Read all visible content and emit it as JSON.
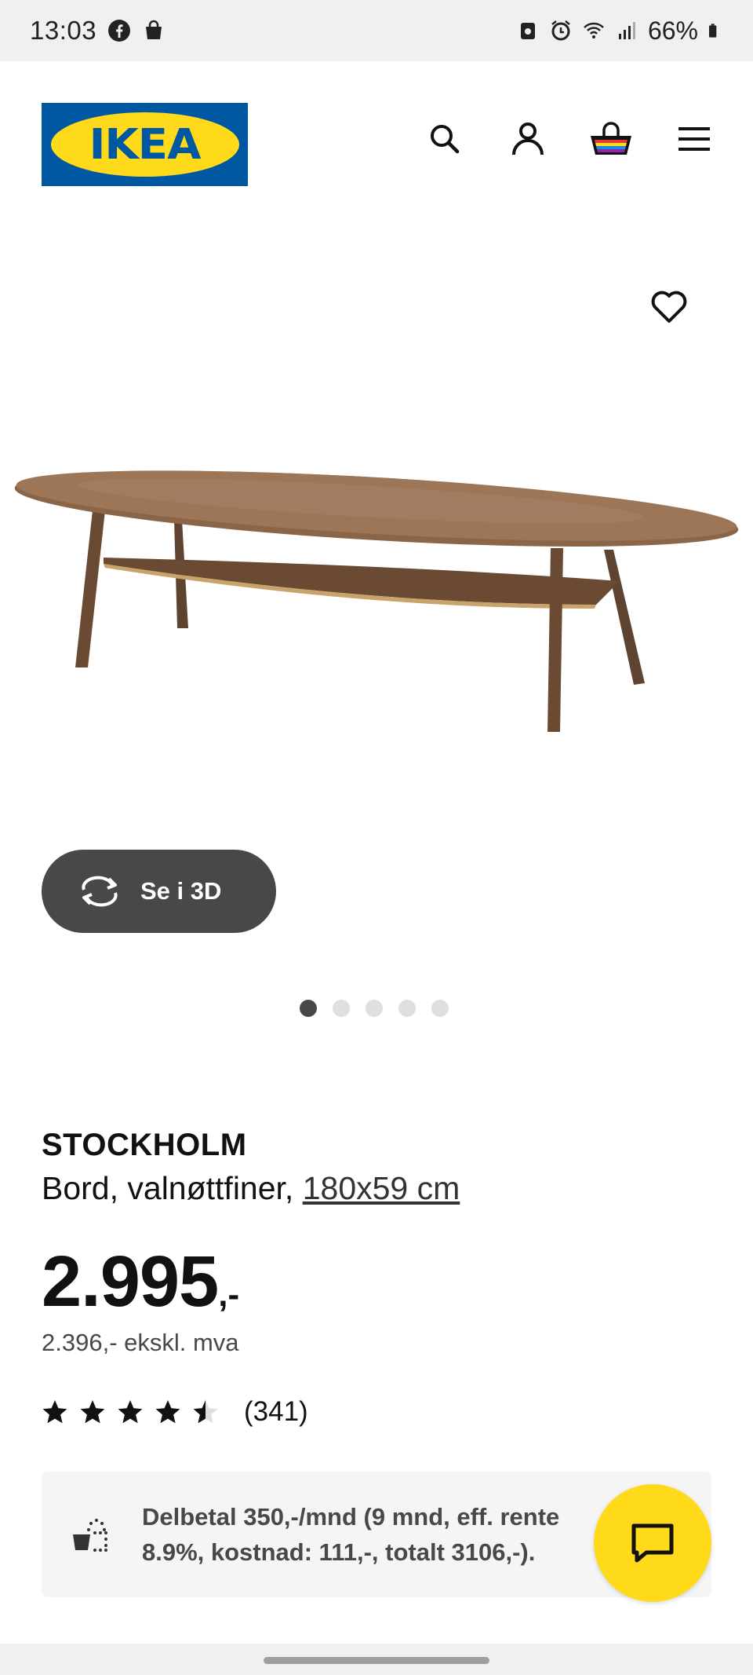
{
  "status_bar": {
    "time": "13:03",
    "battery": "66%",
    "left_icons": [
      "facebook-icon",
      "shopping-bag-icon"
    ],
    "right_icons": [
      "lock-icon",
      "alarm-icon",
      "wifi-icon",
      "signal-icon",
      "battery-icon"
    ]
  },
  "header": {
    "logo_text": "IKEA",
    "icons": [
      "search-icon",
      "account-icon",
      "cart-icon",
      "menu-icon"
    ]
  },
  "gallery": {
    "view_3d_label": "Se i 3D",
    "dot_count": 5,
    "active_dot": 0
  },
  "product": {
    "name": "STOCKHOLM",
    "description": "Bord, valnøttfiner, ",
    "size": "180x59 cm",
    "price_main": "2.995",
    "price_suffix": ",-",
    "price_ex_vat": "2.396,- ekskl. mva",
    "rating": 4.5,
    "rating_count": "(341)"
  },
  "installment": {
    "text": "Delbetal 350,-/mnd (9 mnd, eff. rente 8.9%, kostnad: 111,-, totalt 3106,-)."
  },
  "colors": {
    "ikea_blue": "#0058a3",
    "ikea_yellow": "#ffda1a",
    "dark_button": "#484848"
  }
}
